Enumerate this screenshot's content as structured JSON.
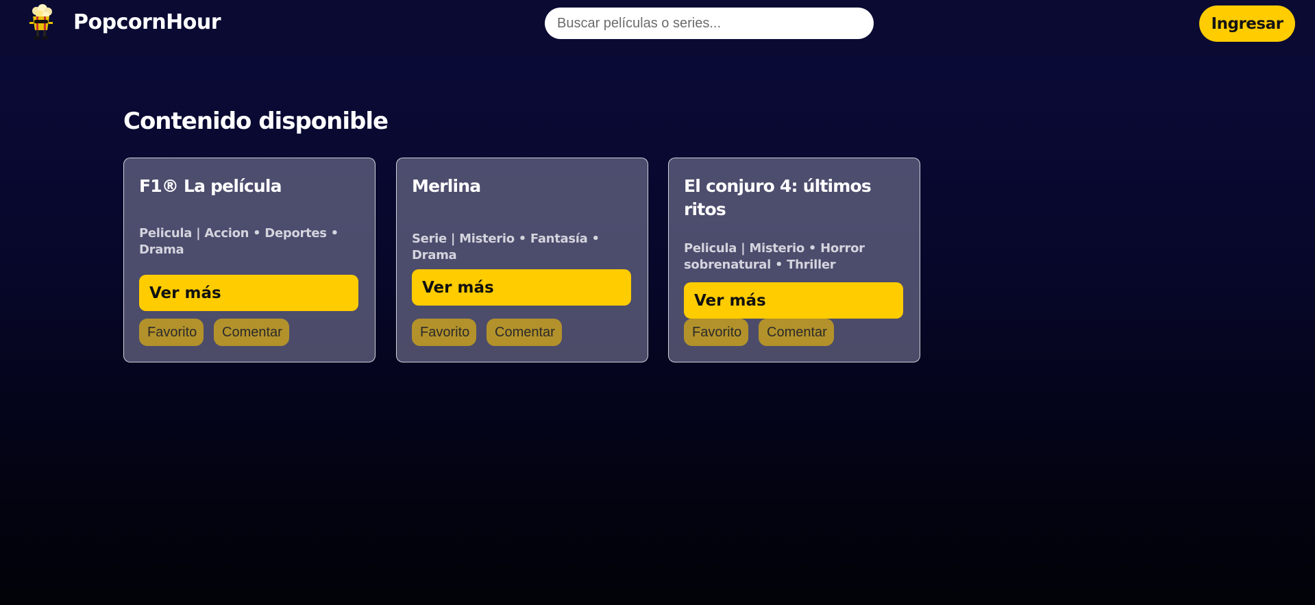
{
  "header": {
    "brand": "PopcornHour",
    "search_placeholder": "Buscar películas o series...",
    "login_label": "Ingresar"
  },
  "main": {
    "section_title": "Contenido disponible",
    "cards": [
      {
        "title": "F1® La película",
        "meta": "Pelicula | Accion • Deportes • Drama",
        "more_label": "Ver más",
        "favorite_label": "Favorito",
        "comment_label": "Comentar"
      },
      {
        "title": "Merlina",
        "meta": "Serie | Misterio • Fantasía • Drama",
        "more_label": "Ver más",
        "favorite_label": "Favorito",
        "comment_label": "Comentar"
      },
      {
        "title": "El conjuro 4: últimos ritos",
        "meta": "Pelicula | Misterio • Horror sobrenatural • Thriller",
        "more_label": "Ver más",
        "favorite_label": "Favorito",
        "comment_label": "Comentar"
      }
    ]
  },
  "icons": {
    "logo": "popcorn-mascot-icon"
  },
  "colors": {
    "accent": "#ffcc00",
    "header_bg": "#0a0a33",
    "card_bg": "#6f6f90",
    "secondary_button": "#b3922b"
  }
}
